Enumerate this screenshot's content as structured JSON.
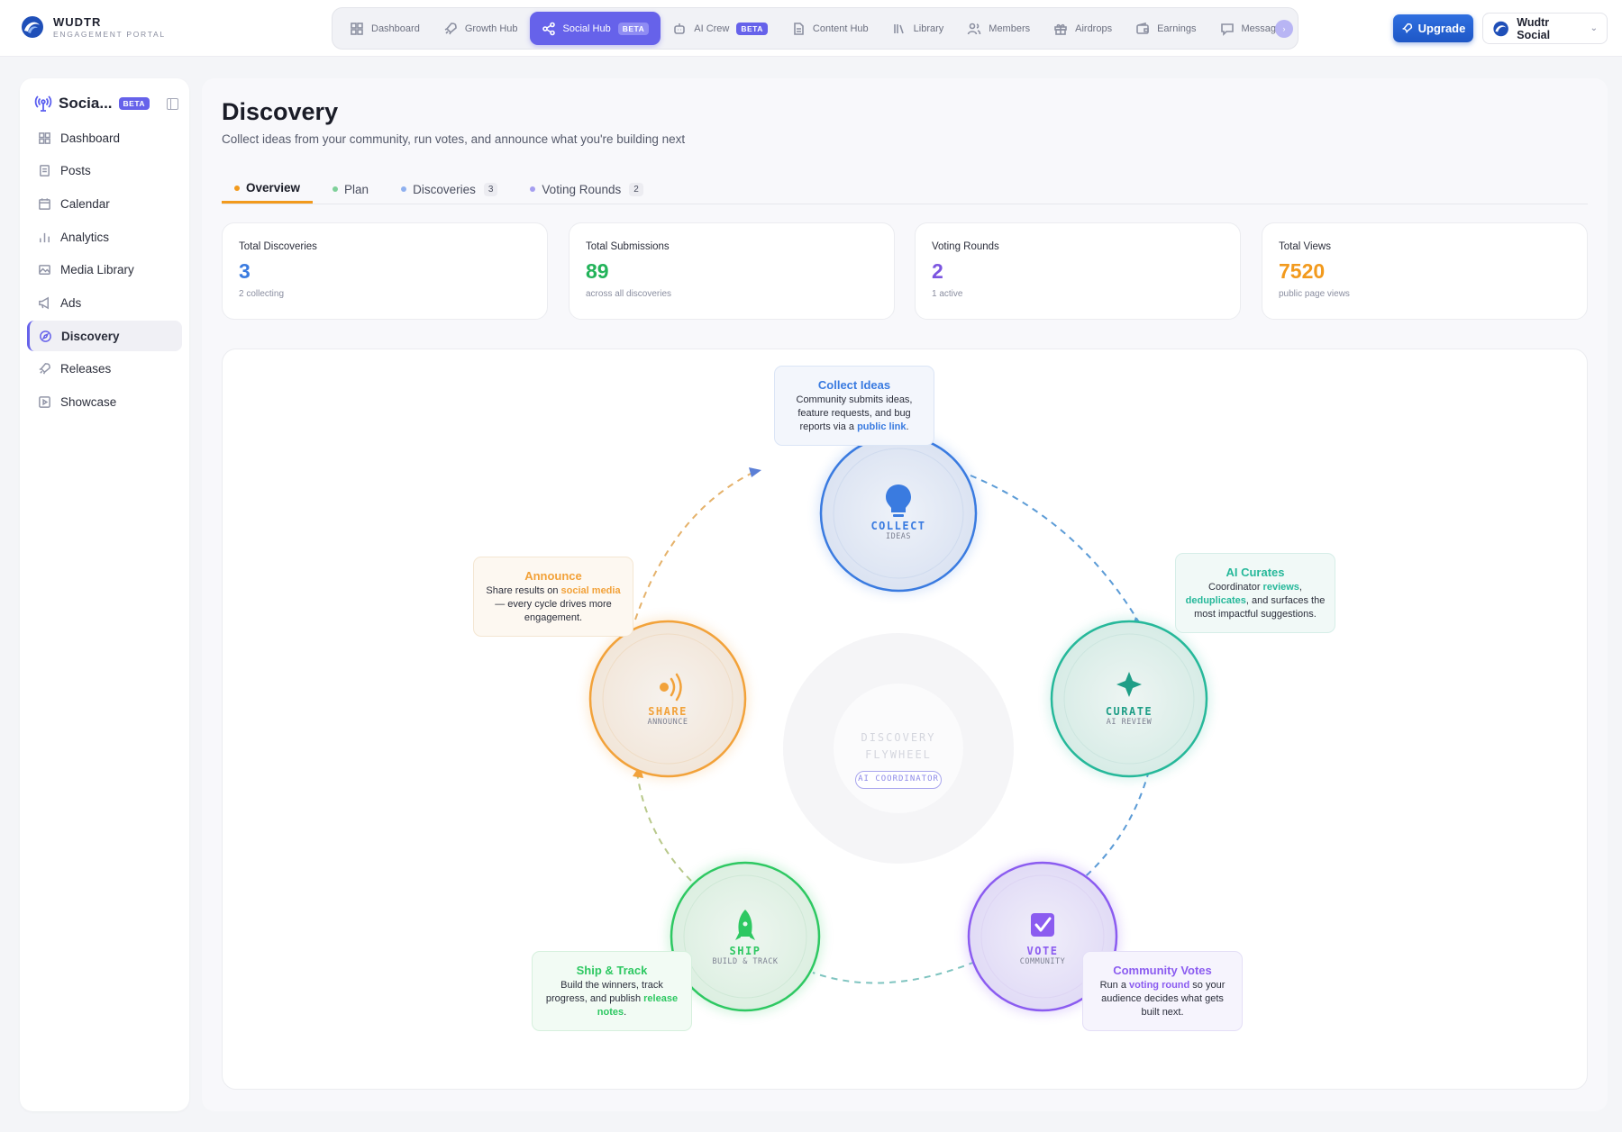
{
  "brand": {
    "name": "WUDTR",
    "subtitle": "ENGAGEMENT PORTAL"
  },
  "topnav": {
    "items": [
      {
        "label": "Dashboard",
        "icon": "grid-icon"
      },
      {
        "label": "Growth Hub",
        "icon": "rocket-icon"
      },
      {
        "label": "Social Hub",
        "icon": "share-icon",
        "badge": "BETA",
        "active": true
      },
      {
        "label": "AI Crew",
        "icon": "robot-icon",
        "badge": "BETA"
      },
      {
        "label": "Content Hub",
        "icon": "document-icon"
      },
      {
        "label": "Library",
        "icon": "library-icon"
      },
      {
        "label": "Members",
        "icon": "users-icon"
      },
      {
        "label": "Airdrops",
        "icon": "gift-icon"
      },
      {
        "label": "Earnings",
        "icon": "wallet-icon"
      },
      {
        "label": "Message",
        "icon": "chat-icon"
      }
    ]
  },
  "header": {
    "upgrade_label": "Upgrade",
    "account_name": "Wudtr Social"
  },
  "sidebar": {
    "title": "Socia...",
    "badge": "BETA",
    "items": [
      {
        "label": "Dashboard",
        "icon": "grid-icon"
      },
      {
        "label": "Posts",
        "icon": "document-icon"
      },
      {
        "label": "Calendar",
        "icon": "calendar-icon"
      },
      {
        "label": "Analytics",
        "icon": "bar-chart-icon"
      },
      {
        "label": "Media Library",
        "icon": "image-icon"
      },
      {
        "label": "Ads",
        "icon": "megaphone-icon"
      },
      {
        "label": "Discovery",
        "icon": "compass-icon",
        "active": true
      },
      {
        "label": "Releases",
        "icon": "rocket-icon"
      },
      {
        "label": "Showcase",
        "icon": "play-icon"
      }
    ]
  },
  "page": {
    "title": "Discovery",
    "subtitle": "Collect ideas from your community, run votes, and announce what you're building next"
  },
  "tabs": [
    {
      "label": "Overview",
      "color": "#f29a1d",
      "active": true
    },
    {
      "label": "Plan",
      "color": "#7fd09a"
    },
    {
      "label": "Discoveries",
      "color": "#8fb0ef",
      "count": "3"
    },
    {
      "label": "Voting Rounds",
      "color": "#a59ef0",
      "count": "2"
    }
  ],
  "stats": [
    {
      "label": "Total Discoveries",
      "value": "3",
      "sub": "2 collecting",
      "color": "#3a7be0"
    },
    {
      "label": "Total Submissions",
      "value": "89",
      "sub": "across all discoveries",
      "color": "#23b35a"
    },
    {
      "label": "Voting Rounds",
      "value": "2",
      "sub": "1 active",
      "color": "#7b55e0"
    },
    {
      "label": "Total Views",
      "value": "7520",
      "sub": "public page views",
      "color": "#f29a1d"
    }
  ],
  "flywheel": {
    "center_title_1": "DISCOVERY",
    "center_title_2": "FLYWHEEL",
    "center_badge": "AI COORDINATOR",
    "nodes": {
      "collect": {
        "title": "COLLECT",
        "sub": "IDEAS",
        "color": "#3a7be0"
      },
      "curate": {
        "title": "CURATE",
        "sub": "AI REVIEW",
        "color": "#26b89a"
      },
      "vote": {
        "title": "VOTE",
        "sub": "COMMUNITY",
        "color": "#8b5cf0"
      },
      "ship": {
        "title": "SHIP",
        "sub": "BUILD & TRACK",
        "color": "#2ec862"
      },
      "share": {
        "title": "SHARE",
        "sub": "ANNOUNCE",
        "color": "#f2a23a"
      }
    },
    "cards": {
      "collect": {
        "title": "Collect Ideas",
        "pre": "Community submits ideas, feature requests, and bug reports via a ",
        "hl": "public link",
        "post": "."
      },
      "curate": {
        "title": "AI Curates",
        "pre": "Coordinator ",
        "hl": "reviews",
        "mid": ", ",
        "hl2": "deduplicates",
        "post": ", and surfaces the most impactful suggestions."
      },
      "vote": {
        "title": "Community Votes",
        "pre": "Run a ",
        "hl": "voting round",
        "post": " so your audience decides what gets built next."
      },
      "ship": {
        "title": "Ship & Track",
        "pre": "Build the winners, track progress, and publish ",
        "hl": "release notes",
        "post": "."
      },
      "announce": {
        "title": "Announce",
        "pre": "Share results on ",
        "hl": "social media",
        "post": " — every cycle drives more engagement."
      }
    }
  }
}
